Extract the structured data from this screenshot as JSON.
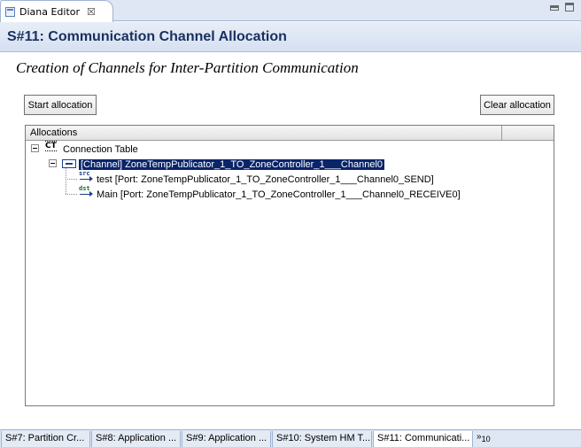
{
  "editor_tab": {
    "label": "Diana Editor",
    "close_glyph": "☒"
  },
  "header": {
    "title": "S#11: Communication Channel Allocation"
  },
  "subtitle": "Creation of Channels for Inter-Partition Communication",
  "buttons": {
    "start": "Start allocation",
    "clear": "Clear allocation"
  },
  "tree": {
    "columns": [
      "Allocations",
      ""
    ],
    "root": {
      "icon_text": "CT",
      "label": "Connection Table"
    },
    "channel": {
      "label": "[Channel] ZoneTempPublicator_1_TO_ZoneController_1___Channel0"
    },
    "ports": [
      {
        "icon_text": "src",
        "label": "test [Port: ZoneTempPublicator_1_TO_ZoneController_1___Channel0_SEND]"
      },
      {
        "icon_text": "dst",
        "label": "Main [Port: ZoneTempPublicator_1_TO_ZoneController_1___Channel0_RECEIVE0]"
      }
    ]
  },
  "bottom_tabs": [
    {
      "label": "S#7: Partition Cr..."
    },
    {
      "label": "S#8: Application ..."
    },
    {
      "label": "S#9: Application ..."
    },
    {
      "label": "S#10: System HM T..."
    },
    {
      "label": "S#11: Communicati..."
    }
  ],
  "overflow": {
    "glyph": "»",
    "count": "10"
  },
  "colors": {
    "selection": "#0a246a",
    "title": "#18305e",
    "header_bg": "#d5e0f1"
  }
}
